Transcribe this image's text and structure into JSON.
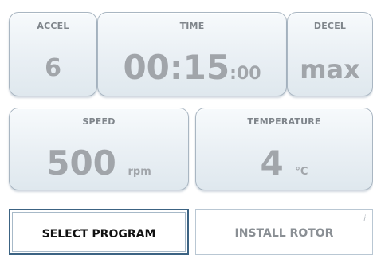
{
  "accel": {
    "label": "ACCEL",
    "value": "6"
  },
  "time": {
    "label": "TIME",
    "hm": "00:15",
    "seconds": ":00"
  },
  "decel": {
    "label": "DECEL",
    "value": "max"
  },
  "speed": {
    "label": "SPEED",
    "value": "500",
    "unit": "rpm"
  },
  "temperature": {
    "label": "TEMPERATURE",
    "value": "4",
    "unit": "°C"
  },
  "buttons": {
    "select_program": "SELECT PROGRAM",
    "install_rotor": "INSTALL ROTOR",
    "info_glyph": "i"
  }
}
